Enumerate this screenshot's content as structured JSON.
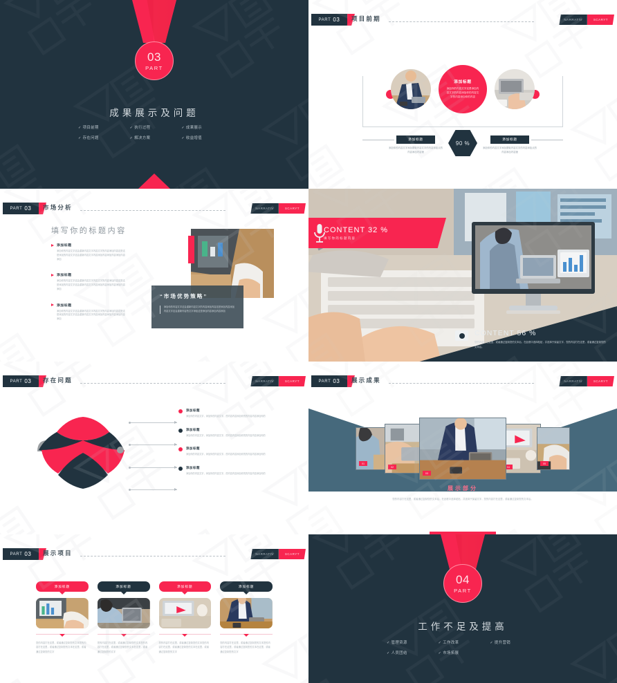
{
  "theme": {
    "red": "#F82550",
    "navy": "#21333F",
    "steel": "#46697C",
    "muted": "#a8b1b7"
  },
  "header_common": {
    "part_label": "PART",
    "part_num": "03",
    "right_badge_dark": "NARRATIV",
    "right_badge_red": "SCARYT"
  },
  "slides": [
    {
      "id": "section-cover-03",
      "kind": "cover",
      "num": "03",
      "part": "PART",
      "title": "成果展示及问题",
      "items": [
        "项目前期",
        "执行过程",
        "成果展示",
        "存在问题",
        "解决方案",
        "收益增值"
      ]
    },
    {
      "id": "project-early-stage",
      "kind": "hub",
      "header_title": "项目前期",
      "center": {
        "title": "添加标题",
        "desc": "添加你的内容文字这是添加内容文字的内容添加你的内容文字的内容添加你的内容"
      },
      "hex_value": "90 %",
      "left": {
        "tag": "添加标题",
        "desc": "添加你的内容文字添加更取内容文字的内容添加点的内容添加内容速"
      },
      "right": {
        "tag": "添加标题",
        "desc": "添加你的内容文字添加更取内容文字的内容添加点的内容添加内容速"
      }
    },
    {
      "id": "market-analysis",
      "kind": "list-photo",
      "header_title": "市场分析",
      "heading": "填写你的标题内容",
      "items": [
        {
          "title": "添加标题",
          "desc": "添加你的内容文字这会重新内容文字内容文字的内容添加内容这是这是添加的内容文字这会重新内容文字内容添加内容添加内容添加内容添加"
        },
        {
          "title": "添加标题",
          "desc": "添加你的内容文字这会重新内容文字内容文字的内容添加内容这是这是添加的内容文字这会重新内容文字内容添加内容添加内容添加内容添加"
        },
        {
          "title": "添加标题",
          "desc": "添加你的内容文字这会重新内容文字内容文字的内容添加内容这是这是添加的内容文字这会重新内容文字内容添加内容添加内容添加内容添加"
        }
      ],
      "quote": {
        "title": "“市场优势策略”",
        "desc": "添加你的内容文字这会重新内容文字的内容添加内容这是添加内容添加内容文字这会重新内容的文字添加这是添加内容添加内容添加"
      }
    },
    {
      "id": "content-percent",
      "kind": "photo-content",
      "banner": {
        "title": "CONTENT 32 %",
        "subtitle": "填写你的标题内容",
        "icon": "microphone-icon"
      },
      "footer": {
        "title": "CONTENT  56 %",
        "desc": "您的内容打在这里，或者通过复制您的文本后，在此框中选择粘贴，并选择只保留文字，您的内容打在这里，或者通过复制您的文本后。",
        "icon": "camera-icon"
      }
    },
    {
      "id": "existing-problems",
      "kind": "umbrella",
      "header_title": "存在问题",
      "items": [
        {
          "title": "添加标题",
          "desc": "添加你的内容文字，添加你的内容文字，的内容内容添加你的的内容内容添加你的",
          "color": "red"
        },
        {
          "title": "添加标题",
          "desc": "添加你的内容文字，添加你的内容文字，的内容内容添加你的的内容内容添加你的",
          "color": "navy"
        },
        {
          "title": "添加标题",
          "desc": "添加你的内容文字，添加你的内容文字，的内容内容添加你的的内容内容添加你的",
          "color": "red"
        },
        {
          "title": "添加标题",
          "desc": "添加你的内容文字，添加你的内容文字，的内容内容添加你的的内容内容添加你的",
          "color": "navy"
        }
      ]
    },
    {
      "id": "show-results",
      "kind": "gallery",
      "header_title": "展示成果",
      "caption_title": "展示部分",
      "caption_desc": "您的内容打在这里，或者通过复制您的文本后，在此框中选择粘贴，并选择只保留文字，您的内容打在这里，或者通过复制您的文本后。",
      "cards": [
        {
          "tag": "01"
        },
        {
          "tag": "02"
        },
        {
          "tag": "03"
        },
        {
          "tag": "04"
        },
        {
          "tag": "05"
        }
      ]
    },
    {
      "id": "show-projects",
      "kind": "four-cards",
      "header_title": "展示项目",
      "cards": [
        {
          "tag": "添加标题",
          "style": "red",
          "desc": "您的内容打在这里，或者通过复制您的文本您的内容打在这里，或者通过复制您的文本在这里，或者通过复制您的文字"
        },
        {
          "tag": "添加标题",
          "style": "navy",
          "desc": "您的内容打在这里，或者通过复制您的文本您的内容打在这里，或者通过复制您的文本在这里，或者通过复制您的文字"
        },
        {
          "tag": "添加标题",
          "style": "red",
          "desc": "您的内容打在这里，或者通过复制您的文本您的内容打在这里，或者通过复制您的文本在这里，或者通过复制您的文字"
        },
        {
          "tag": "添加标题",
          "style": "navy",
          "desc": "您的内容打在这里，或者通过复制您的文本您的内容打在这里，或者通过复制您的文本在这里，或者通过复制您的文字"
        }
      ]
    },
    {
      "id": "section-cover-04",
      "kind": "cover",
      "num": "04",
      "part": "PART",
      "title": "工作不足及提高",
      "items": [
        "管理资源",
        "工作改革",
        "提升营销",
        "人员团结",
        "市场拓展"
      ]
    }
  ]
}
